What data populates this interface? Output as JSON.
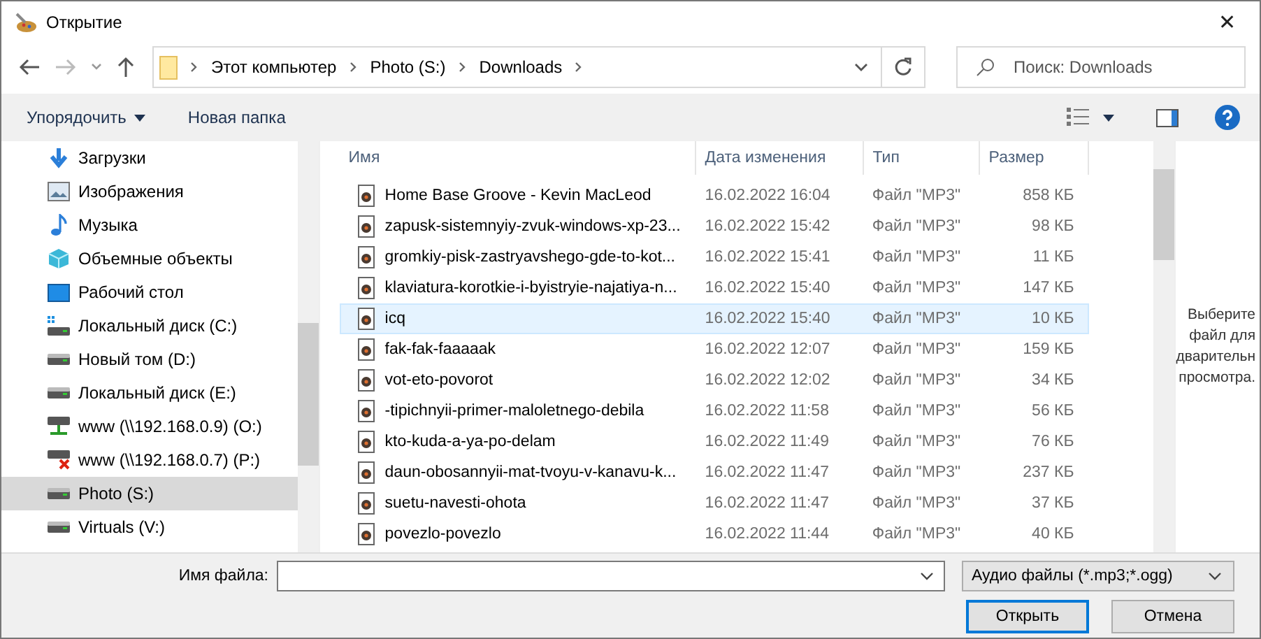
{
  "window": {
    "title": "Открытие",
    "close": "✕"
  },
  "breadcrumb": [
    "Этот компьютер",
    "Photo (S:)",
    "Downloads"
  ],
  "search": {
    "placeholder": "Поиск: Downloads"
  },
  "toolbar": {
    "organize": "Упорядочить",
    "new_folder": "Новая папка"
  },
  "sidebar": {
    "items": [
      {
        "label": "Загрузки",
        "kind": "download",
        "selected": false
      },
      {
        "label": "Изображения",
        "kind": "pictures",
        "selected": false
      },
      {
        "label": "Музыка",
        "kind": "music",
        "selected": false
      },
      {
        "label": "Объемные объекты",
        "kind": "objects",
        "selected": false
      },
      {
        "label": "Рабочий стол",
        "kind": "desktop",
        "selected": false
      },
      {
        "label": "Локальный диск (C:)",
        "kind": "system",
        "selected": false
      },
      {
        "label": "Новый том (D:)",
        "kind": "drive",
        "selected": false
      },
      {
        "label": "Локальный диск (E:)",
        "kind": "drive",
        "selected": false
      },
      {
        "label": "www (\\\\192.168.0.9) (O:)",
        "kind": "net",
        "selected": false
      },
      {
        "label": "www (\\\\192.168.0.7) (P:)",
        "kind": "netoff",
        "selected": false
      },
      {
        "label": "Photo (S:)",
        "kind": "drive",
        "selected": true
      },
      {
        "label": "Virtuals (V:)",
        "kind": "drive",
        "selected": false
      }
    ]
  },
  "table": {
    "columns": [
      "Имя",
      "Дата изменения",
      "Тип",
      "Размер"
    ],
    "rows": [
      {
        "name": "Home Base Groove - Kevin MacLeod",
        "date": "16.02.2022 16:04",
        "type": "Файл \"MP3\"",
        "size": "858 КБ",
        "selected": false
      },
      {
        "name": "zapusk-sistemnyiy-zvuk-windows-xp-23...",
        "date": "16.02.2022 15:42",
        "type": "Файл \"MP3\"",
        "size": "98 КБ",
        "selected": false
      },
      {
        "name": "gromkiy-pisk-zastryavshego-gde-to-kot...",
        "date": "16.02.2022 15:41",
        "type": "Файл \"MP3\"",
        "size": "11 КБ",
        "selected": false
      },
      {
        "name": "klaviatura-korotkie-i-byistryie-najatiya-n...",
        "date": "16.02.2022 15:40",
        "type": "Файл \"MP3\"",
        "size": "147 КБ",
        "selected": false
      },
      {
        "name": "icq",
        "date": "16.02.2022 15:40",
        "type": "Файл \"MP3\"",
        "size": "10 КБ",
        "selected": true
      },
      {
        "name": "fak-fak-faaaaak",
        "date": "16.02.2022 12:07",
        "type": "Файл \"MP3\"",
        "size": "159 КБ",
        "selected": false
      },
      {
        "name": "vot-eto-povorot",
        "date": "16.02.2022 12:02",
        "type": "Файл \"MP3\"",
        "size": "34 КБ",
        "selected": false
      },
      {
        "name": "-tipichnyii-primer-maloletnego-debila",
        "date": "16.02.2022 11:58",
        "type": "Файл \"MP3\"",
        "size": "56 КБ",
        "selected": false
      },
      {
        "name": "kto-kuda-a-ya-po-delam",
        "date": "16.02.2022 11:49",
        "type": "Файл \"MP3\"",
        "size": "76 КБ",
        "selected": false
      },
      {
        "name": "daun-obosannyii-mat-tvoyu-v-kanavu-k...",
        "date": "16.02.2022 11:47",
        "type": "Файл \"MP3\"",
        "size": "237 КБ",
        "selected": false
      },
      {
        "name": "suetu-navesti-ohota",
        "date": "16.02.2022 11:47",
        "type": "Файл \"MP3\"",
        "size": "37 КБ",
        "selected": false
      },
      {
        "name": "povezlo-povezlo",
        "date": "16.02.2022 11:44",
        "type": "Файл \"MP3\"",
        "size": "40 КБ",
        "selected": false
      }
    ]
  },
  "preview": [
    "Выберите",
    "файл для",
    "дварительн",
    "просмотра."
  ],
  "filename": {
    "label": "Имя файла:"
  },
  "filter": "Аудио файлы (*.mp3;*.ogg)",
  "buttons": [
    "Открыть",
    "Отмена"
  ]
}
